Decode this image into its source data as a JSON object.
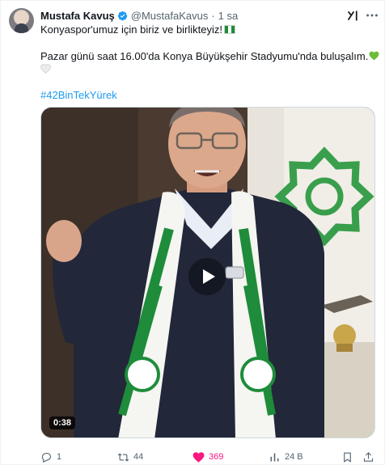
{
  "author": {
    "name": "Mustafa Kavuş",
    "handle": "@MustafaKavus",
    "separator": "·",
    "time": "1 sa"
  },
  "tweet": {
    "line1": "Konyaspor'umuz için biriz ve birlikteyiz!",
    "line2": "Pazar günü saat 16.00'da Konya Büyükşehir Stadyumu'nda buluşalım.",
    "hashtag": "#42BinTekYürek"
  },
  "media": {
    "duration": "0:38"
  },
  "actions": {
    "replies": "1",
    "retweets": "44",
    "likes": "369",
    "views": "24 B"
  },
  "colors": {
    "like_active": "#f91880",
    "link": "#1d9bf0",
    "muted": "#536471",
    "verified": "#1d9bf0",
    "konyaspor_green": "#1e8c3a"
  },
  "icons": [
    "verified-badge-icon",
    "grok-icon",
    "more-icon",
    "flag-icon",
    "green-heart-icon",
    "white-heart-icon",
    "play-icon",
    "reply-icon",
    "retweet-icon",
    "like-icon",
    "views-icon",
    "bookmark-icon",
    "share-icon"
  ]
}
